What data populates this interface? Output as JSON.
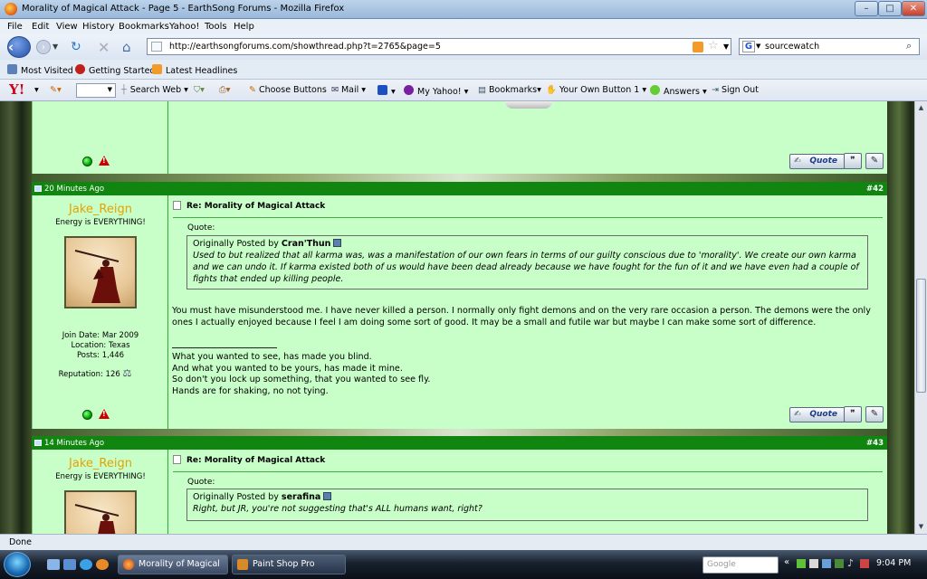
{
  "window": {
    "title": "Morality of Magical Attack - Page 5 - EarthSong Forums - Mozilla Firefox"
  },
  "menu": [
    "File",
    "Edit",
    "View",
    "History",
    "Bookmarks",
    "Yahoo!",
    "Tools",
    "Help"
  ],
  "nav": {
    "url": "http://earthsongforums.com/showthread.php?t=2765&page=5",
    "search_value": "sourcewatch"
  },
  "bookmarks": [
    "Most Visited",
    "Getting Started",
    "Latest Headlines"
  ],
  "yahoo_toolbar": {
    "search_web": "Search Web",
    "choose_buttons": "Choose Buttons",
    "mail": "Mail",
    "my_yahoo": "My Yahoo!",
    "bookmarks": "Bookmarks",
    "own_button": "Your Own Button 1",
    "answers": "Answers",
    "sign_out": "Sign Out"
  },
  "posts": [
    {
      "date": "20 Minutes Ago",
      "number": "#42",
      "user": {
        "name": "Jake_Reign",
        "title": "Energy is EVERYTHING!",
        "join_date": "Join Date: Mar 2009",
        "location": "Location: Texas",
        "posts": "Posts: 1,446",
        "reputation": "Reputation: 126"
      },
      "title": "Re: Morality of Magical Attack",
      "quote_label": "Quote:",
      "quote_prefix": "Originally Posted by",
      "quote_author": "Cran'Thun",
      "quote_text": "Used to but realized that all karma was, was a manifestation of our own fears in terms of our guilty conscious due to 'morality'. We create our own karma and we can undo it. If karma existed both of us would have been dead already because we have fought for the fun of it and we have even had a couple of fights that ended up killing people.",
      "body": "You must have misunderstood me. I have never killed a person. I normally only fight demons and on the very rare occasion a person. The demons were the only ones I actually enjoyed because I feel I am doing some sort of good. It may be a small and futile war but maybe I can make some sort of difference.",
      "signature": [
        "What you wanted to see, has made you blind.",
        "And what you wanted to be yours, has made it mine.",
        "So don't you lock up something, that you wanted to see fly.",
        "Hands are for shaking, no not tying."
      ],
      "quote_button": "Quote"
    },
    {
      "date": "14 Minutes Ago",
      "number": "#43",
      "user": {
        "name": "Jake_Reign",
        "title": "Energy is EVERYTHING!"
      },
      "title": "Re: Morality of Magical Attack",
      "quote_label": "Quote:",
      "quote_prefix": "Originally Posted by",
      "quote_author": "serafina",
      "quote_text": "Right, but JR, you're not suggesting that's ALL humans want, right?"
    }
  ],
  "prev_post": {
    "quote_button": "Quote"
  },
  "status": "Done",
  "taskbar": {
    "tasks": [
      "Morality of Magical ...",
      "Paint Shop Pro"
    ],
    "search_placeholder": "Google",
    "clock": "9:04 PM"
  }
}
